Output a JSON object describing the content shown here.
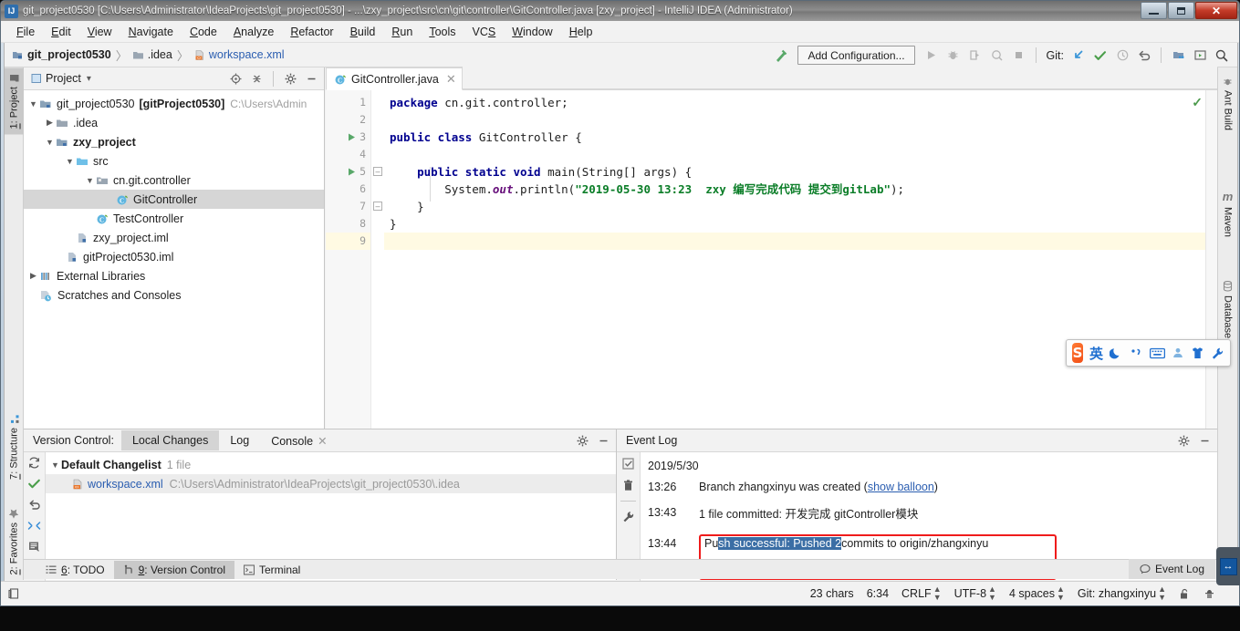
{
  "window": {
    "title": "git_project0530 [C:\\Users\\Administrator\\IdeaProjects\\git_project0530] - ...\\zxy_project\\src\\cn\\git\\controller\\GitController.java [zxy_project] - IntelliJ IDEA (Administrator)",
    "app_icon": "IJ",
    "minimize": "minimize-icon",
    "maximize": "maximize-icon",
    "close": "✕"
  },
  "menubar": {
    "items": [
      {
        "pre": "F",
        "rest": "ile"
      },
      {
        "pre": "E",
        "rest": "dit"
      },
      {
        "pre": "V",
        "rest": "iew"
      },
      {
        "pre": "N",
        "rest": "avigate"
      },
      {
        "pre": "C",
        "rest": "ode"
      },
      {
        "pre": "A",
        "rest": "nalyze"
      },
      {
        "pre": "R",
        "rest": "efactor"
      },
      {
        "pre": "B",
        "rest": "uild"
      },
      {
        "pre": "R",
        "rest": "un"
      },
      {
        "pre": "T",
        "rest": "ools"
      },
      {
        "pre": "VC",
        "rest": "S"
      },
      {
        "pre": "W",
        "rest": "indow"
      },
      {
        "pre": "H",
        "rest": "elp"
      }
    ]
  },
  "navbar": {
    "breadcrumb": [
      {
        "label": "git_project0530",
        "style": "bold",
        "icon": "module-icon"
      },
      {
        "label": ".idea",
        "style": "plain",
        "icon": "folder-icon"
      },
      {
        "label": "workspace.xml",
        "style": "link",
        "icon": "xml-file-icon"
      }
    ],
    "separator": "〉",
    "add_configuration": "Add Configuration...",
    "git_label": "Git:",
    "buttons": {
      "hammer": "build-hammer-icon",
      "run": "run-icon",
      "debug": "debug-icon",
      "run_coverage": "run-with-coverage-icon",
      "profile": "profiler-icon",
      "stop": "stop-icon",
      "update_project": "git-update-project-icon",
      "commit": "git-commit-icon",
      "history": "git-history-icon",
      "rollback": "git-rollback-icon",
      "open_settings": "project-structure-icon",
      "run_anything": "run-anything-icon",
      "search": "search-everywhere-icon"
    }
  },
  "left_strip": {
    "tabs": [
      {
        "num": "1",
        "label": ": Project",
        "active": true,
        "icon": "project-icon"
      },
      {
        "num": "7",
        "label": ": Structure",
        "active": false,
        "icon": "structure-icon"
      },
      {
        "num": "2",
        "label": ": Favorites",
        "active": false,
        "icon": "star-icon"
      }
    ]
  },
  "right_strip": {
    "tabs": [
      {
        "label": "Ant Build",
        "icon": "ant-icon"
      },
      {
        "label": "Maven",
        "icon": "maven-icon"
      },
      {
        "label": "Database",
        "icon": "database-icon"
      }
    ]
  },
  "project_panel": {
    "title": "Project",
    "dropdown": "▾",
    "buttons": {
      "locate": "scroll-from-source-icon",
      "collapse": "collapse-all-icon",
      "settings": "gear-icon",
      "hide": "hide-icon"
    },
    "tree": [
      {
        "indent": 0,
        "arrow": "v",
        "icon": "module-icon",
        "label": "git_project0530",
        "bold_suffix": "[gitProject0530]",
        "path": "C:\\Users\\Admin",
        "selected": false
      },
      {
        "indent": 1,
        "arrow": ">",
        "icon": "folder-icon",
        "label": ".idea",
        "selected": false
      },
      {
        "indent": 1,
        "arrow": "v",
        "icon": "module-icon",
        "label": "zxy_project",
        "bold": true,
        "selected": false
      },
      {
        "indent": 2,
        "arrow": "v",
        "icon": "source-folder-icon",
        "label": "src",
        "selected": false
      },
      {
        "indent": 3,
        "arrow": "v",
        "icon": "package-icon",
        "label": "cn.git.controller",
        "selected": false
      },
      {
        "indent": 4,
        "arrow": "",
        "icon": "java-class-icon",
        "label": "GitController",
        "selected": true
      },
      {
        "indent": 3,
        "arrow": "",
        "icon": "java-class-icon",
        "label": "TestController",
        "selected": false
      },
      {
        "indent": 2,
        "arrow": "",
        "icon": "iml-file-icon",
        "label": "zxy_project.iml",
        "selected": false
      },
      {
        "indent": 2,
        "arrow": "",
        "icon": "iml-file-icon",
        "label": "gitProject0530.iml",
        "selected": false
      },
      {
        "indent": 0,
        "arrow": ">",
        "icon": "libraries-icon",
        "label": "External Libraries",
        "selected": false
      },
      {
        "indent": 0,
        "arrow": "",
        "icon": "scratches-icon",
        "label": "Scratches and Consoles",
        "selected": false
      }
    ]
  },
  "editor": {
    "tab": {
      "label": "GitController.java",
      "icon": "java-class-icon",
      "close": "✕"
    },
    "line_numbers": [
      "1",
      "2",
      "3",
      "4",
      "5",
      "6",
      "7",
      "8",
      "9"
    ],
    "current_line": 9,
    "inspection_status": "✓",
    "lines": [
      {
        "n": 1,
        "segments": [
          {
            "t": "package ",
            "c": "kw"
          },
          {
            "t": "cn.git.controller;",
            "c": ""
          }
        ]
      },
      {
        "n": 2,
        "segments": [
          {
            "t": "",
            "c": ""
          }
        ]
      },
      {
        "n": 3,
        "segments": [
          {
            "t": "public class ",
            "c": "kw"
          },
          {
            "t": "GitController {",
            "c": ""
          }
        ],
        "runmark": true
      },
      {
        "n": 4,
        "segments": [
          {
            "t": "",
            "c": ""
          }
        ]
      },
      {
        "n": 5,
        "segments": [
          {
            "t": "    ",
            "c": ""
          },
          {
            "t": "public static void ",
            "c": "kw"
          },
          {
            "t": "main(String[] args) {",
            "c": ""
          }
        ],
        "runmark": true,
        "fold": true
      },
      {
        "n": 6,
        "segments": [
          {
            "t": "        System.",
            "c": ""
          },
          {
            "t": "out",
            "c": "fld"
          },
          {
            "t": ".println(",
            "c": ""
          },
          {
            "t": "\"2019-05-30 13:23  zxy 编写完成代码 提交到gitLab\"",
            "c": "str"
          },
          {
            "t": ");",
            "c": ""
          }
        ]
      },
      {
        "n": 7,
        "segments": [
          {
            "t": "    }",
            "c": ""
          }
        ],
        "fold": true
      },
      {
        "n": 8,
        "segments": [
          {
            "t": "}",
            "c": ""
          }
        ]
      },
      {
        "n": 9,
        "segments": [
          {
            "t": "",
            "c": ""
          }
        ]
      }
    ]
  },
  "version_control": {
    "title": "Version Control:",
    "tabs": [
      {
        "label": "Local Changes",
        "active": true,
        "closable": false
      },
      {
        "label": "Log",
        "active": false,
        "closable": false
      },
      {
        "label": "Console",
        "active": false,
        "closable": true
      }
    ],
    "buttons": {
      "settings": "gear-icon",
      "hide": "hide-icon"
    },
    "side_icons": [
      "refresh-icon",
      "commit-check-icon",
      "rollback-icon",
      "shelve-icon",
      "notes-icon",
      "more-icon"
    ],
    "changelist": {
      "arrow": "v",
      "name": "Default Changelist",
      "count": "1 file",
      "files": [
        {
          "icon": "xml-file-icon",
          "name": "workspace.xml",
          "path": "C:\\Users\\Administrator\\IdeaProjects\\git_project0530\\.idea"
        }
      ]
    }
  },
  "event_log": {
    "title": "Event Log",
    "buttons": {
      "settings": "gear-icon",
      "hide": "hide-icon"
    },
    "side_icons": [
      "mark-all-read-icon",
      "delete-icon",
      "settings-wrench-icon"
    ],
    "date": "2019/5/30",
    "entries": [
      {
        "time": "13:26",
        "pre": "Branch zhangxinyu was created (",
        "link": "show balloon",
        "post": ")"
      },
      {
        "time": "13:43",
        "pre": "1 file committed: 开发完成  gitController模块",
        "link": "",
        "post": ""
      },
      {
        "time": "13:44",
        "pre": "Pu",
        "highlight": "sh successful: Pushed 2",
        "post": " commits to origin/zhangxinyu",
        "boxed": true
      }
    ]
  },
  "bottom_tabs": [
    {
      "num": "6",
      "label": ": TODO",
      "icon": "todo-icon",
      "active": false
    },
    {
      "num": "9",
      "label": ": Version Control",
      "icon": "vcs-icon",
      "active": true
    },
    {
      "num": "",
      "label": "Terminal",
      "icon": "terminal-icon",
      "active": false
    }
  ],
  "event_log_corner": {
    "label": "Event Log",
    "icon": "balloon-icon"
  },
  "statusbar": {
    "left_icon": "toggle-toolwindows-icon",
    "items": [
      {
        "label": "23 chars",
        "arrows": false
      },
      {
        "label": "6:34",
        "arrows": false
      },
      {
        "label": "CRLF",
        "arrows": true
      },
      {
        "label": "UTF-8",
        "arrows": true
      },
      {
        "label": "4 spaces",
        "arrows": true
      },
      {
        "label": "Git: zhangxinyu",
        "arrows": true
      }
    ],
    "lock_icon": "unlocked-icon",
    "inspect_icon": "inspection-hector-icon"
  },
  "ime_toolbar": {
    "logo": "S",
    "mode": "英",
    "icons": [
      "moon-icon",
      "punctuation-icon",
      "soft-keyboard-icon",
      "user-icon",
      "skin-icon",
      "toolbox-icon"
    ]
  },
  "floating_widget": {
    "icon": "teamviewer-arrows-icon"
  },
  "colors": {
    "accent_blue": "#2a5db0",
    "selection_blue": "#3b6ea5",
    "string_green": "#0a7d27",
    "keyword_navy": "#00008f",
    "field_purple": "#660e7a",
    "alert_red": "#ef1b1b",
    "panel_gray": "#f2f2f2",
    "tree_selected": "#d6d6d6",
    "current_line": "#fffae3"
  }
}
